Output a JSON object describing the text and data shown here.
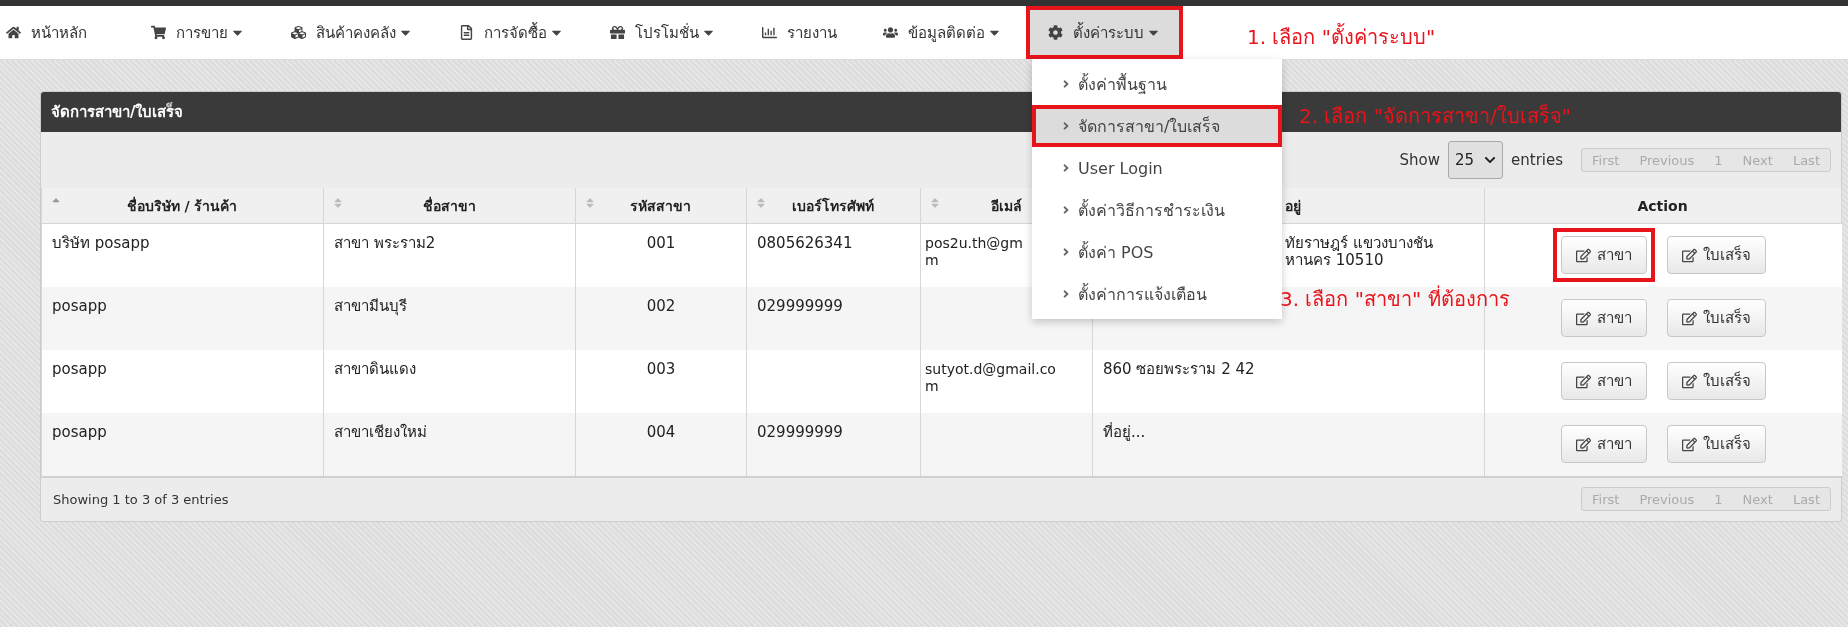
{
  "nav": [
    {
      "label": "หน้าหลัก",
      "caret": false,
      "active": false,
      "annotated": false
    },
    {
      "label": "การขาย",
      "caret": true,
      "active": false,
      "annotated": false
    },
    {
      "label": "สินค้าคงคลัง",
      "caret": true,
      "active": false,
      "annotated": false
    },
    {
      "label": "การจัดซื้อ",
      "caret": true,
      "active": false,
      "annotated": false
    },
    {
      "label": "โปรโมชั่น",
      "caret": true,
      "active": false,
      "annotated": false
    },
    {
      "label": "รายงาน",
      "caret": false,
      "active": false,
      "annotated": false
    },
    {
      "label": "ข้อมูลติดต่อ",
      "caret": true,
      "active": false,
      "annotated": false
    },
    {
      "label": "ตั้งค่าระบบ",
      "caret": true,
      "active": true,
      "annotated": true
    }
  ],
  "dropdown": {
    "items": [
      {
        "label": "ตั้งค่าพื้นฐาน",
        "selected": false,
        "annotated": false
      },
      {
        "label": "จัดการสาขา/ใบเสร็จ",
        "selected": true,
        "annotated": true
      },
      {
        "label": "User Login",
        "selected": false,
        "annotated": false
      },
      {
        "label": "ตั้งค่าวิธีการชำระเงิน",
        "selected": false,
        "annotated": false
      },
      {
        "label": "ตั้งค่า POS",
        "selected": false,
        "annotated": false
      },
      {
        "label": "ตั้งค่าการแจ้งเตือน",
        "selected": false,
        "annotated": false
      }
    ]
  },
  "annotations": [
    {
      "text": "1. เลือก \"ตั้งค่าระบบ\""
    },
    {
      "text": "2. เลือก \"จัดการสาขา/ใบเสร็จ\""
    },
    {
      "text": "3. เลือก \"สาขา\" ที่ต้องการ"
    }
  ],
  "panel": {
    "title": "จัดการสาขา/ใบเสร็จ",
    "length": {
      "label_before": "Show",
      "value": "25",
      "label_after": "entries"
    },
    "pagination_top": [
      {
        "label": "First",
        "disabled": true
      },
      {
        "label": "Previous",
        "disabled": true
      },
      {
        "label": "1",
        "disabled": true
      },
      {
        "label": "Next",
        "disabled": true
      },
      {
        "label": "Last",
        "disabled": true
      }
    ],
    "columns": [
      {
        "label": "ชื่อบริษัท / ร้านค้า",
        "sortable": true,
        "sorted": true
      },
      {
        "label": "ชื่อสาขา",
        "sortable": true,
        "sorted": false
      },
      {
        "label": "รหัสสาขา",
        "sortable": true,
        "sorted": false
      },
      {
        "label": "เบอร์โทรศัพท์",
        "sortable": true,
        "sorted": false
      },
      {
        "label": "อีเมล์",
        "sortable": true,
        "sorted": false
      },
      {
        "label": "อยู่",
        "kind": "partial"
      },
      {
        "label": "Action",
        "sortable": false
      }
    ],
    "rows": [
      {
        "company": "บริษัท posapp",
        "branch": "สาขา พระราม2",
        "code": "001",
        "phone": "0805626341",
        "email": [
          "pos2u.th@gm",
          "m"
        ],
        "address": [
          "ทัยราษฎร์ แขวงบางชัน",
          "หานคร 10510"
        ],
        "actions": [
          {
            "label": "สาขา",
            "annotated": true
          },
          {
            "label": "ใบเสร็จ",
            "annotated": false
          }
        ]
      },
      {
        "company": "posapp",
        "branch": "สาขามีนบุรี",
        "code": "002",
        "phone": "029999999",
        "actions": [
          {
            "label": "สาขา",
            "annotated": false
          },
          {
            "label": "ใบเสร็จ",
            "annotated": false
          }
        ]
      },
      {
        "company": "posapp",
        "branch": "สาขาดินแดง",
        "code": "003",
        "email": [
          "sutyot.d@gmail.co",
          "m"
        ],
        "address": [
          "860 ซอยพระราม 2 42"
        ],
        "actions": [
          {
            "label": "สาขา",
            "annotated": false
          },
          {
            "label": "ใบเสร็จ",
            "annotated": false
          }
        ]
      },
      {
        "company": "posapp",
        "branch": "สาขาเชียงใหม่",
        "code": "004",
        "phone": "029999999",
        "address": [
          "ที่อยู่..."
        ],
        "actions": [
          {
            "label": "สาขา",
            "annotated": false
          },
          {
            "label": "ใบเสร็จ",
            "annotated": false
          }
        ]
      }
    ],
    "info": "Showing 1 to 3 of 3 entries",
    "pagination_bottom": [
      {
        "label": "First",
        "disabled": true
      },
      {
        "label": "Previous",
        "disabled": true
      },
      {
        "label": "1",
        "disabled": true
      },
      {
        "label": "Next",
        "disabled": true
      },
      {
        "label": "Last",
        "disabled": true
      }
    ]
  }
}
